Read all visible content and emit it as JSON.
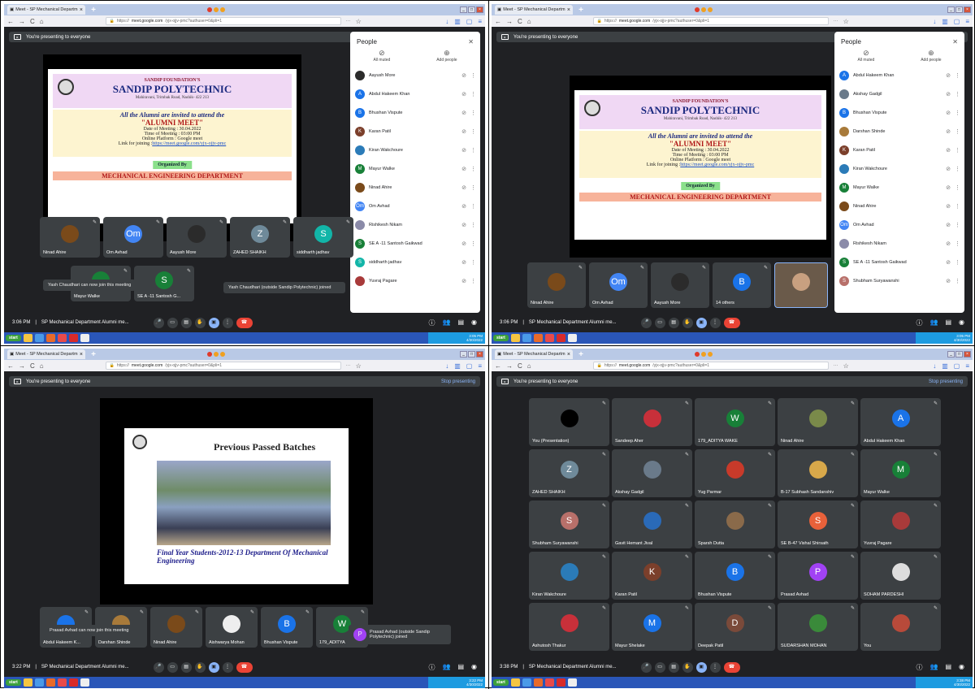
{
  "browser": {
    "tab_title": "Meet - SP Mechanical Departm",
    "url_prefix": "https://",
    "url_domain": "meet.google.com",
    "url_path": "/yjx-ojjv-pmc?authuser=0&pli=1"
  },
  "present": {
    "label": "You're presenting to everyone",
    "stop": "Stop presenting"
  },
  "invite": {
    "foundation": "SANDIP FOUNDATION'S",
    "college": "SANDIP POLYTECHNIC",
    "address": "Mahiravani, Trimbak Road, Nashik- 422 213",
    "line1": "All the Alumni are invited to attend the",
    "line2": "\"ALUMNI MEET\"",
    "date": "Date of Meeting : 30.04.2022",
    "time": "Time of Meeting : 03:00 PM",
    "platform": "Online Platform : Google meet",
    "link_label": "Link for joining :",
    "link": "https://meet.google.com/yjx-ojjv-pmc",
    "organized": "Organized By",
    "dept": "MECHANICAL ENGINEERING DEPARTMENT"
  },
  "people": {
    "title": "People",
    "all_muted": "All muted",
    "add_people": "Add people"
  },
  "people_list_1": [
    {
      "name": "Aayush More",
      "initial": "",
      "color": "#2b2b2b"
    },
    {
      "name": "Abdul Hakeem Khan",
      "initial": "A",
      "color": "#1a73e8"
    },
    {
      "name": "Bhushan Vispute",
      "initial": "B",
      "color": "#1a73e8"
    },
    {
      "name": "Karan Patil",
      "initial": "K",
      "color": "#7b3f2b"
    },
    {
      "name": "Kiran Wakchoure",
      "initial": "",
      "color": "#2b7bb8"
    },
    {
      "name": "Mayur Walke",
      "initial": "M",
      "color": "#188038"
    },
    {
      "name": "Ninad Ahire",
      "initial": "",
      "color": "#7a4a1a"
    },
    {
      "name": "Om Avhad",
      "initial": "Om",
      "color": "#4285f4"
    },
    {
      "name": "Rishikesh Nikam",
      "initial": "",
      "color": "#8a8aa8"
    },
    {
      "name": "SE A -11 Santosh Gaikwad",
      "initial": "S",
      "color": "#188038"
    },
    {
      "name": "siddharth jadhav",
      "initial": "S",
      "color": "#12b5a8"
    },
    {
      "name": "Yuvraj Pagare",
      "initial": "",
      "color": "#a83a3a"
    }
  ],
  "people_list_2": [
    {
      "name": "Abdul Hakeem Khan",
      "initial": "A",
      "color": "#1a73e8"
    },
    {
      "name": "Akshay Gadgil",
      "initial": "",
      "color": "#6a7a8a"
    },
    {
      "name": "Bhushan Vispute",
      "initial": "B",
      "color": "#1a73e8"
    },
    {
      "name": "Darshan Shinde",
      "initial": "",
      "color": "#a87a3a"
    },
    {
      "name": "Karan Patil",
      "initial": "K",
      "color": "#7b3f2b"
    },
    {
      "name": "Kiran Wakchoure",
      "initial": "",
      "color": "#2b7bb8"
    },
    {
      "name": "Mayur Walke",
      "initial": "M",
      "color": "#188038"
    },
    {
      "name": "Ninad Ahire",
      "initial": "",
      "color": "#7a4a1a"
    },
    {
      "name": "Om Avhad",
      "initial": "Om",
      "color": "#4285f4"
    },
    {
      "name": "Rishikesh Nikam",
      "initial": "",
      "color": "#8a8aa8"
    },
    {
      "name": "SE A -11 Santosh Gaikwad",
      "initial": "S",
      "color": "#188038"
    },
    {
      "name": "Shubham Suryawanshi",
      "initial": "S",
      "color": "#b8706a"
    }
  ],
  "q1": {
    "tiles": [
      {
        "name": "Ninad Ahire",
        "initial": "",
        "color": "#7a4a1a"
      },
      {
        "name": "Om Avhad",
        "initial": "Om",
        "color": "#4285f4"
      },
      {
        "name": "Aayush More",
        "initial": "",
        "color": "#2b2b2b"
      },
      {
        "name": "ZAHED SHAIKH",
        "initial": "Z",
        "color": "#6f8a9a"
      },
      {
        "name": "siddharth jadhav",
        "initial": "S",
        "color": "#12b5a8"
      }
    ],
    "tiles2": [
      {
        "name": "Mayur Walke",
        "initial": "",
        "color": "#188038"
      },
      {
        "name": "SE A -11 Santosh G...",
        "initial": "S",
        "color": "#188038"
      }
    ],
    "toast_left": "Yash Chaudhari can now join this meeting",
    "toast_right": "Yash Chaudhari (outside Sandip Polytechnic) joined",
    "time": "3:06 PM",
    "meeting": "SP Mechanical Department Alumni me..."
  },
  "q2": {
    "tiles": [
      {
        "name": "Ninad Ahire",
        "initial": "",
        "color": "#7a4a1a"
      },
      {
        "name": "Om Avhad",
        "initial": "Om",
        "color": "#4285f4"
      },
      {
        "name": "Aayush More",
        "initial": "",
        "color": "#2b2b2b"
      },
      {
        "name": "14 others",
        "initial": "B",
        "color": "#1a73e8"
      }
    ],
    "time": "3:06 PM",
    "meeting": "SP Mechanical Department Alumni me..."
  },
  "q3": {
    "title": "Previous Passed Batches",
    "caption": "Final Year Students-2012-13 Department Of Mechanical Engineering",
    "tiles": [
      {
        "name": "Abdul Hakeem K...",
        "initial": "",
        "color": "#1a73e8"
      },
      {
        "name": "Darshan Shinde",
        "initial": "",
        "color": "#a87a3a"
      },
      {
        "name": "Ninad Ahire",
        "initial": "",
        "color": "#7a4a1a"
      },
      {
        "name": "Aishwarya Mohan",
        "initial": "",
        "color": "#eee"
      },
      {
        "name": "Bhushan Vispute",
        "initial": "B",
        "color": "#1a73e8"
      },
      {
        "name": "179_ADITYA",
        "initial": "W",
        "color": "#188038"
      }
    ],
    "toast_left": "Prasad Avhad can now join this meeting",
    "toast_right": "Prasad Avhad (outside Sandip Polytechnic) joined",
    "time": "3:22 PM",
    "meeting": "SP Mechanical Department Alumni me..."
  },
  "q4": {
    "tiles": [
      {
        "name": "You (Presentation)",
        "initial": "",
        "color": "#000"
      },
      {
        "name": "Sandeep Aher",
        "initial": "",
        "color": "#c8303a"
      },
      {
        "name": "179_ADITYA WAKE",
        "initial": "W",
        "color": "#188038"
      },
      {
        "name": "Ninad Ahire",
        "initial": "",
        "color": "#7a8a4a"
      },
      {
        "name": "Abdul Hakeem Khan",
        "initial": "A",
        "color": "#1a73e8"
      },
      {
        "name": "ZAHED SHAIKH",
        "initial": "Z",
        "color": "#6f8a9a"
      },
      {
        "name": "Akshay Gadgil",
        "initial": "",
        "color": "#6a7a8a"
      },
      {
        "name": "Yug Parmar",
        "initial": "",
        "color": "#c83a2a"
      },
      {
        "name": "B-17 Subhash Sandanshiv",
        "initial": "",
        "color": "#d8a84a"
      },
      {
        "name": "Mayur Walke",
        "initial": "M",
        "color": "#188038"
      },
      {
        "name": "Shubham Suryawanshi",
        "initial": "S",
        "color": "#b8706a"
      },
      {
        "name": "Gavit Hemant Jival",
        "initial": "",
        "color": "#2a6ab8"
      },
      {
        "name": "Sparsh Dutta",
        "initial": "",
        "color": "#8a6a4a"
      },
      {
        "name": "SE B-47 Vishal Shirsath",
        "initial": "S",
        "color": "#e8613a"
      },
      {
        "name": "Yuvraj Pagare",
        "initial": "",
        "color": "#a83a3a"
      },
      {
        "name": "Kiran Wakchoure",
        "initial": "",
        "color": "#2b7bb8"
      },
      {
        "name": "Karan Patil",
        "initial": "K",
        "color": "#7b3f2b"
      },
      {
        "name": "Bhushan Vispute",
        "initial": "B",
        "color": "#1a73e8"
      },
      {
        "name": "Prasad Avhad",
        "initial": "P",
        "color": "#a142f4"
      },
      {
        "name": "SOHAM PARDESHI",
        "initial": "",
        "color": "#ddd"
      },
      {
        "name": "Ashutosh Thakur",
        "initial": "",
        "color": "#c8303a"
      },
      {
        "name": "Mayur Shelake",
        "initial": "M",
        "color": "#1a73e8"
      },
      {
        "name": "Deepak Patil",
        "initial": "D",
        "color": "#7a4a3a"
      },
      {
        "name": "SUDARSHAN MOHAN",
        "initial": "",
        "color": "#3a8a3a"
      },
      {
        "name": "You",
        "initial": "",
        "color": "#b84a3a"
      }
    ],
    "time": "3:38 PM",
    "meeting": "SP Mechanical Department Alumni me..."
  },
  "taskbar": {
    "start": "start",
    "clock1": "3:05 PM",
    "clock3": "3:22 PM",
    "clock4": "3:38 PM",
    "date": "4/30/2022"
  }
}
